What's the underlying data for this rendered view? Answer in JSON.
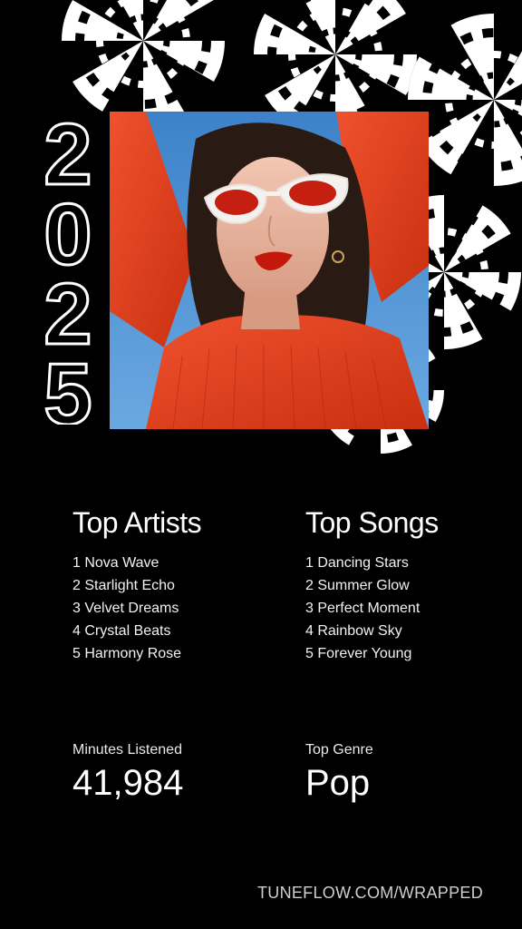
{
  "year": "2025",
  "artists": {
    "heading": "Top Artists",
    "items": [
      "1 Nova Wave",
      "2 Starlight Echo",
      "3 Velvet Dreams",
      "4 Crystal Beats",
      "5 Harmony Rose"
    ]
  },
  "songs": {
    "heading": "Top Songs",
    "items": [
      "1 Dancing Stars",
      "2 Summer Glow",
      "3 Perfect Moment",
      "4 Rainbow Sky",
      "5 Forever Young"
    ]
  },
  "stats": {
    "minutes_label": "Minutes Listened",
    "minutes_value": "41,984",
    "genre_label": "Top Genre",
    "genre_value": "Pop"
  },
  "footer": {
    "url": "TUNEFLOW.COM/WRAPPED"
  },
  "colors": {
    "background": "#000000",
    "text": "#ffffff",
    "accent_red": "#e23a1c",
    "sky_blue": "#4a8fd1"
  },
  "icons": {
    "decoration": "op-art-checkered-circle"
  }
}
